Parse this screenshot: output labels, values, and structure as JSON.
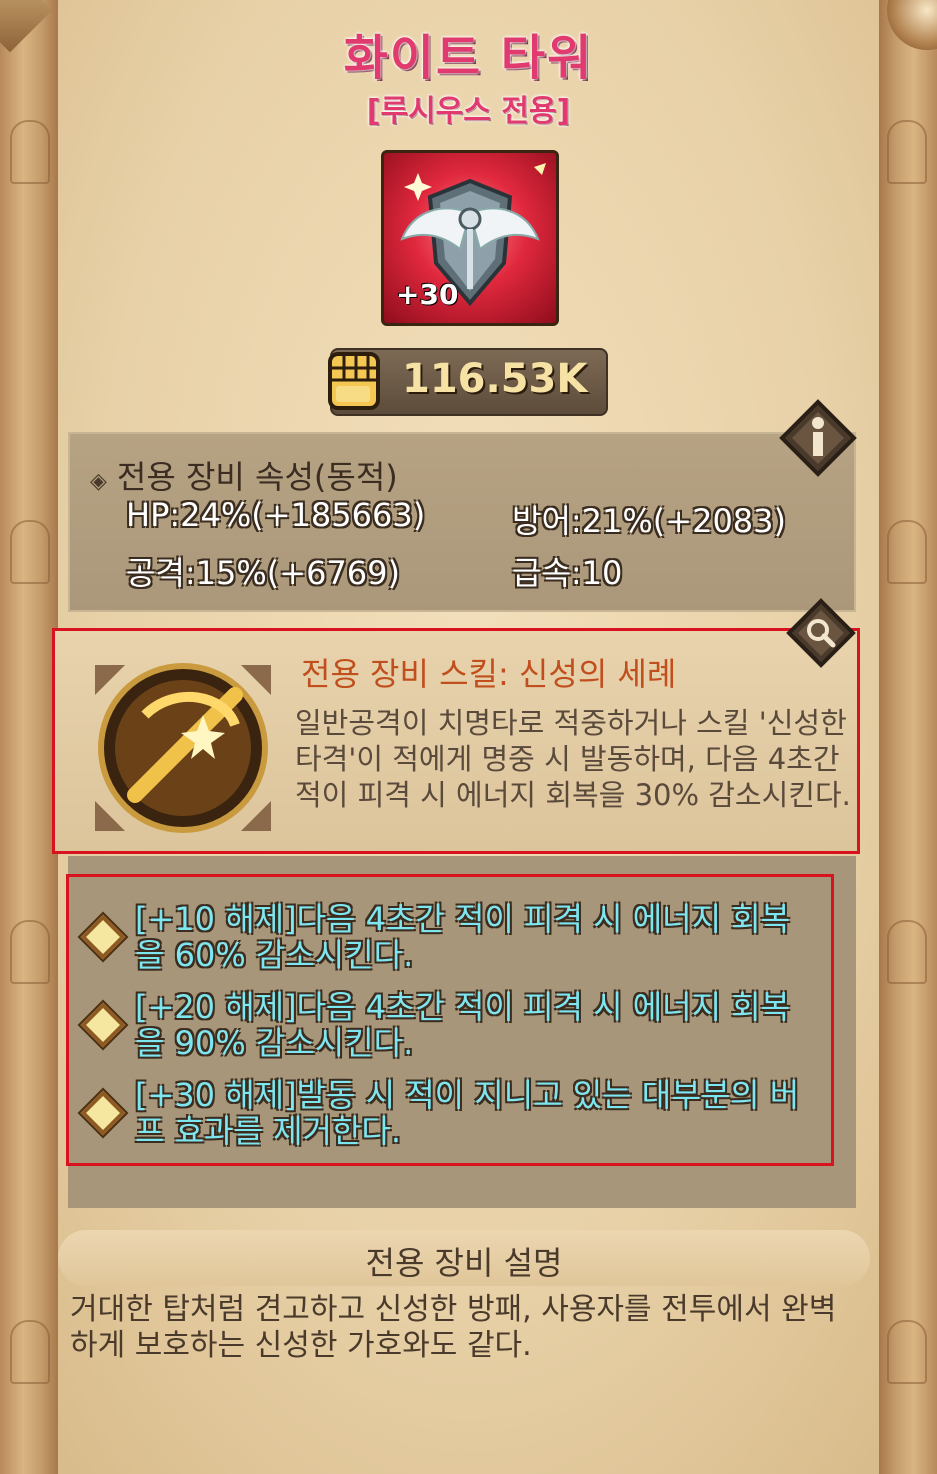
{
  "item": {
    "name": "화이트 타워",
    "restriction": "[루시우스 전용]",
    "enhance_level": "+30",
    "power": "116.53K"
  },
  "attributes": {
    "heading": "전용 장비 속성(동적)",
    "hp": "HP:24%(+185663)",
    "defense": "방어:21%(+2083)",
    "attack": "공격:15%(+6769)",
    "speed": "급속:10"
  },
  "skill": {
    "title": "전용 장비 스킬: 신성의 세례",
    "description": "일반공격이 치명타로 적중하거나 스킬 '신성한 타격'이 적에게 명중 시 발동하며, 다음 4초간 적이 피격 시 에너지 회복을 30% 감소시킨다."
  },
  "unlocks": [
    {
      "text": "[+10 해제]다음 4초간 적이 피격 시 에너지 회복을 60% 감소시킨다."
    },
    {
      "text": "[+20 해제]다음 4초간 적이 피격 시 에너지 회복을 90% 감소시킨다."
    },
    {
      "text": "[+30 해제]발동 시 적이 지니고 있는 대부분의 버프 효과를 제거한다."
    }
  ],
  "description": {
    "heading": "전용 장비 설명",
    "text": "거대한 탑처럼 견고하고 신성한 방패, 사용자를 전투에서 완벽하게 보호하는 신성한 가호와도 같다."
  },
  "icons": {
    "info": "info-icon",
    "search": "magnifier-icon",
    "power": "fist-icon",
    "bullet": "diamond-bullet-icon"
  },
  "colors": {
    "title": "#e03a6e",
    "skill_title": "#c14f1d",
    "unlock_text": "#7ee6f0",
    "highlight_box": "#d8131f"
  }
}
